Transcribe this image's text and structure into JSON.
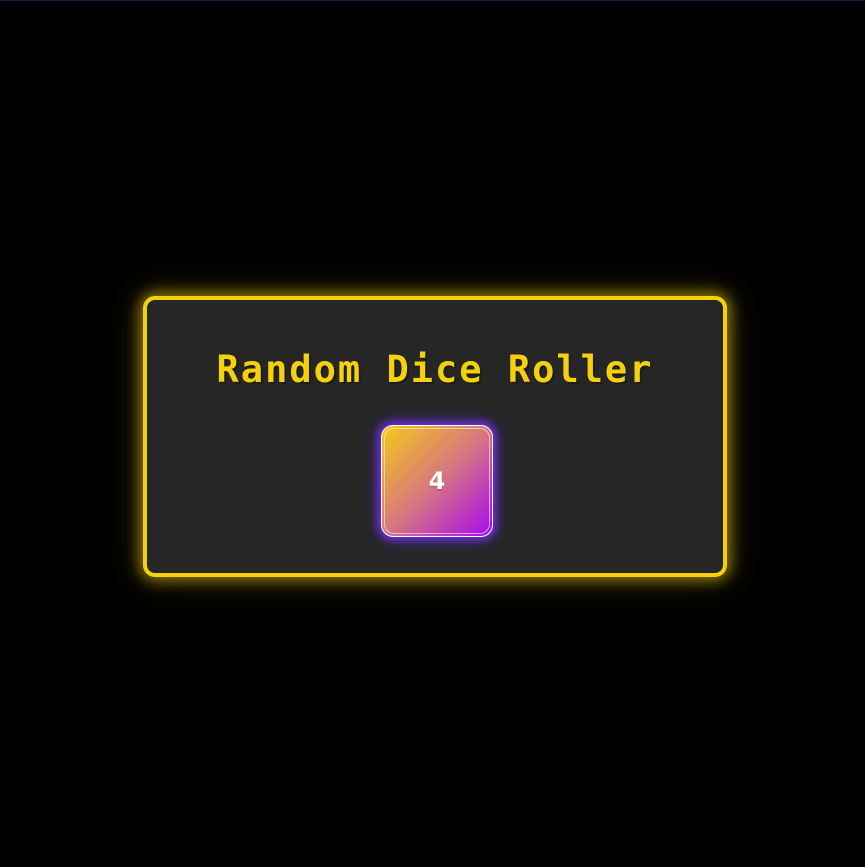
{
  "app": {
    "title": "Random Dice Roller"
  },
  "dice": {
    "value": "4"
  },
  "colors": {
    "background": "#000000",
    "card_background": "#262626",
    "accent": "#f5d00c",
    "dice_gradient_start": "#f6c916",
    "dice_gradient_end": "#a80af0",
    "dice_glow": "#7832ff"
  }
}
